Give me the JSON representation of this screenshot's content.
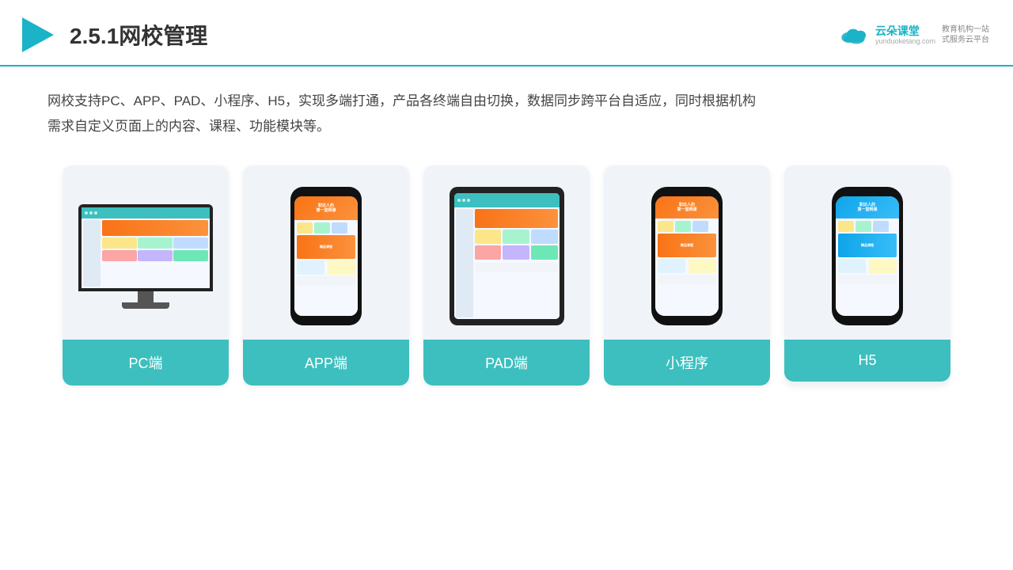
{
  "header": {
    "title": "2.5.1网校管理",
    "logo": {
      "name": "云朵课堂",
      "url": "yunduoketang.com",
      "tagline": "教育机构一站\n式服务云平台"
    }
  },
  "description": "网校支持PC、APP、PAD、小程序、H5，实现多端打通，产品各终端自由切换，数据同步跨平台自适应，同时根据机构\n需求自定义页面上的内容、课程、功能模块等。",
  "cards": [
    {
      "id": "pc",
      "label": "PC端"
    },
    {
      "id": "app",
      "label": "APP端"
    },
    {
      "id": "pad",
      "label": "PAD端"
    },
    {
      "id": "miniprogram",
      "label": "小程序"
    },
    {
      "id": "h5",
      "label": "H5"
    }
  ]
}
